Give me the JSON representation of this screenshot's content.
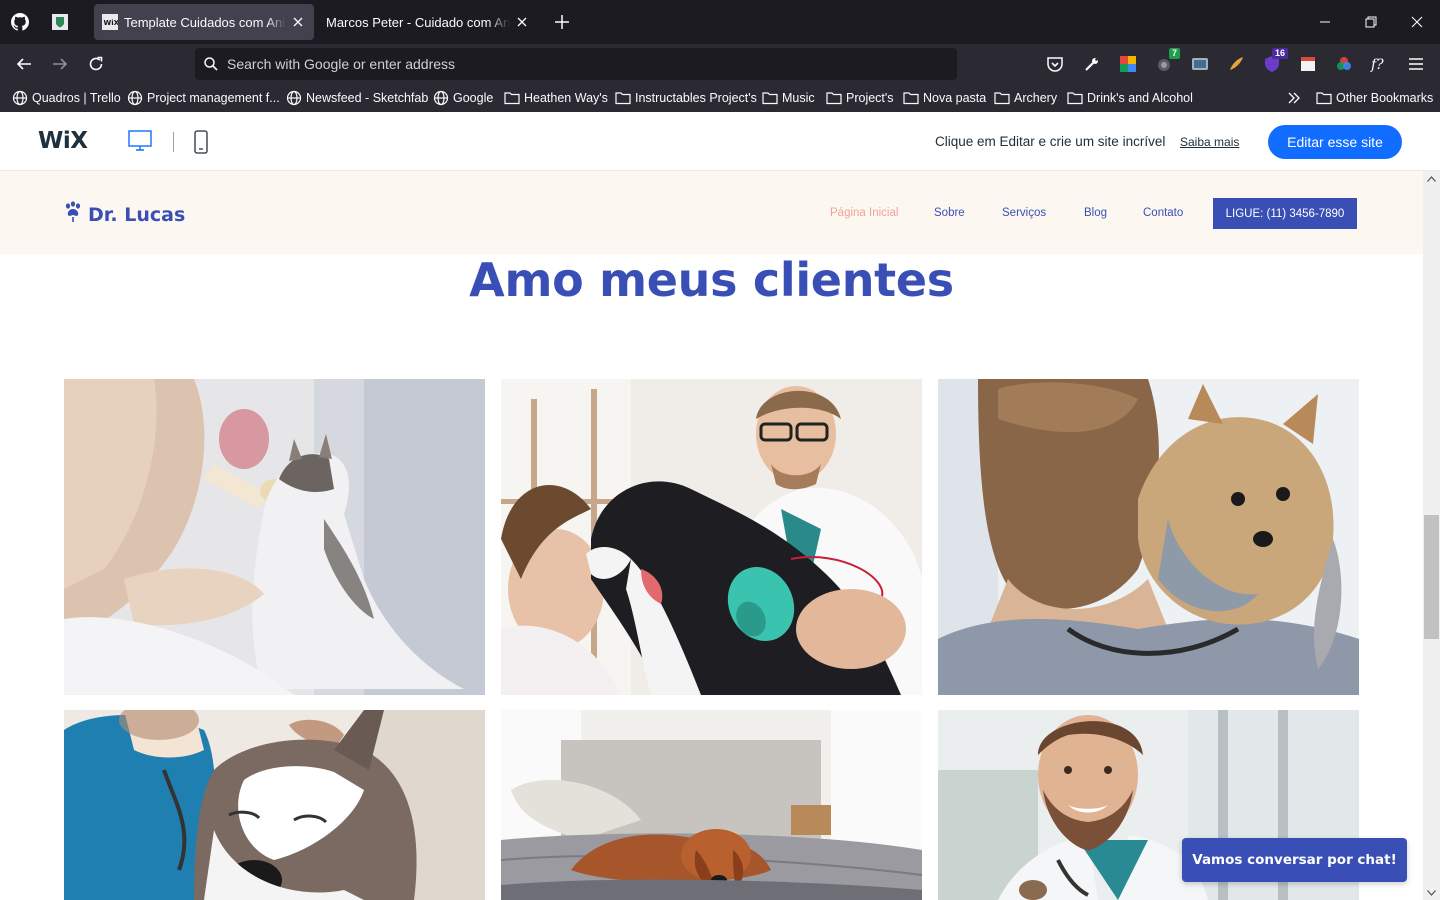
{
  "browser": {
    "tabs": [
      {
        "title": "Template Cuidados com Animais",
        "active": true
      },
      {
        "title": "Marcos Peter - Cuidado com Animais",
        "active": false
      }
    ],
    "url_placeholder": "Search with Google or enter address",
    "extension_badges": {
      "first": "7",
      "second": "16"
    },
    "bookmarks": [
      {
        "label": "Quadros | Trello",
        "icon": "globe-icon"
      },
      {
        "label": "Project management f...",
        "icon": "globe-icon"
      },
      {
        "label": "Newsfeed - Sketchfab",
        "icon": "globe-icon"
      },
      {
        "label": "Google",
        "icon": "globe-icon"
      },
      {
        "label": "Heathen Way's",
        "icon": "folder-icon"
      },
      {
        "label": "Instructables Project's",
        "icon": "folder-icon"
      },
      {
        "label": "Music",
        "icon": "folder-icon"
      },
      {
        "label": "Project's",
        "icon": "folder-icon"
      },
      {
        "label": "Nova pasta",
        "icon": "folder-icon"
      },
      {
        "label": "Archery",
        "icon": "folder-icon"
      },
      {
        "label": "Drink's and Alcohol",
        "icon": "folder-icon"
      }
    ],
    "other_bookmarks": "Other Bookmarks"
  },
  "wix": {
    "logo": "WiX",
    "message": "Clique em Editar e crie um site incrível",
    "learn_more": "Saiba mais",
    "edit_button": "Editar esse site"
  },
  "site": {
    "brand": "Dr. Lucas",
    "menu": [
      "Página Inicial",
      "Sobre",
      "Serviços",
      "Blog",
      "Contato"
    ],
    "call_button": "LIGUE: (11) 3456-7890",
    "section_title": "Amo meus clientes",
    "chat_button": "Vamos conversar por chat!"
  },
  "colors": {
    "brand_blue": "#3a4fb5",
    "active_menu": "#f0a494",
    "header_bg": "#fcf8f1",
    "wix_blue": "#116dff"
  }
}
